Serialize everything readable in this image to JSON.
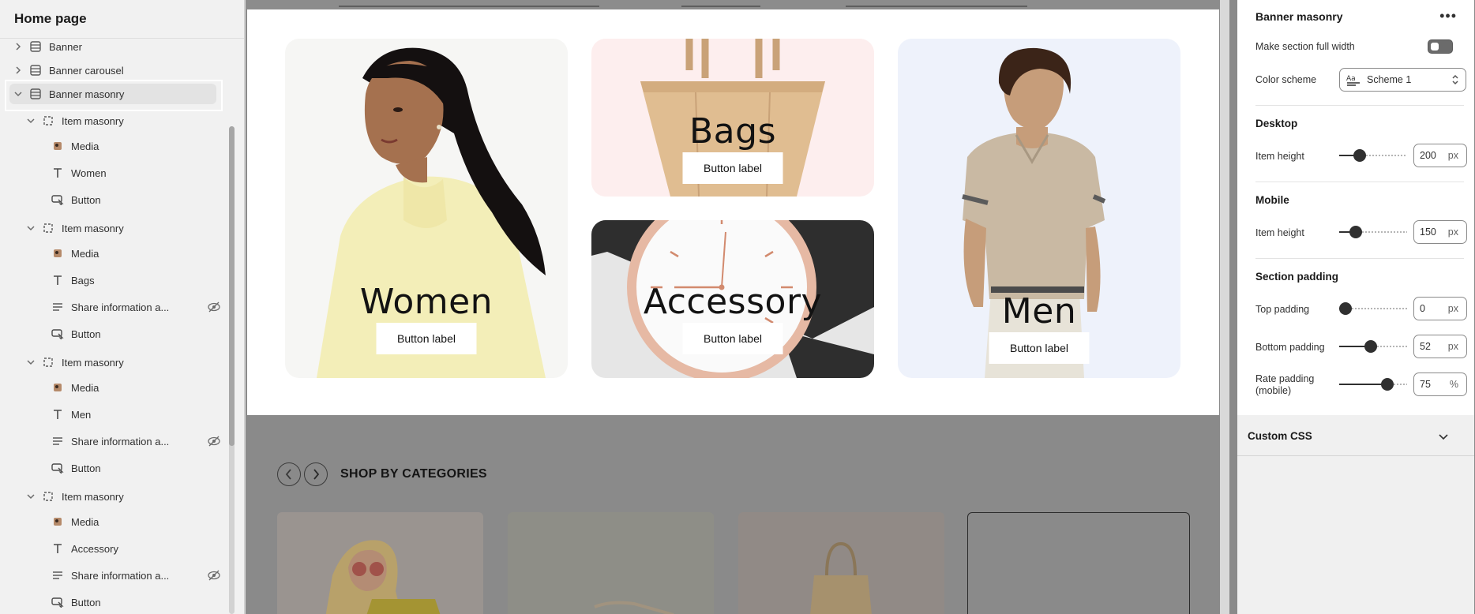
{
  "sidebar": {
    "title": "Home page",
    "tree": [
      {
        "label": "Banner",
        "level": 0,
        "chevron": "right",
        "icon": "section-icon"
      },
      {
        "label": "Banner carousel",
        "level": 0,
        "chevron": "right",
        "icon": "section-icon"
      },
      {
        "label": "Banner masonry",
        "level": 0,
        "chevron": "down",
        "icon": "section-icon",
        "selected": true
      },
      {
        "label": "Item masonry",
        "level": 1,
        "chevron": "down",
        "icon": "block-icon"
      },
      {
        "label": "Media",
        "level": 2,
        "icon": "media-icon"
      },
      {
        "label": "Women",
        "level": 2,
        "icon": "text-icon"
      },
      {
        "label": "Button",
        "level": 2,
        "icon": "button-icon"
      },
      {
        "label": "Item masonry",
        "level": 1,
        "chevron": "down",
        "icon": "block-icon"
      },
      {
        "label": "Media",
        "level": 2,
        "icon": "media-icon"
      },
      {
        "label": "Bags",
        "level": 2,
        "icon": "text-icon"
      },
      {
        "label": "Share information a...",
        "level": 2,
        "icon": "lines-icon",
        "hidden": true
      },
      {
        "label": "Button",
        "level": 2,
        "icon": "button-icon"
      },
      {
        "label": "Item masonry",
        "level": 1,
        "chevron": "down",
        "icon": "block-icon"
      },
      {
        "label": "Media",
        "level": 2,
        "icon": "media-icon"
      },
      {
        "label": "Men",
        "level": 2,
        "icon": "text-icon"
      },
      {
        "label": "Share information a...",
        "level": 2,
        "icon": "lines-icon",
        "hidden": true
      },
      {
        "label": "Button",
        "level": 2,
        "icon": "button-icon"
      },
      {
        "label": "Item masonry",
        "level": 1,
        "chevron": "down",
        "icon": "block-icon"
      },
      {
        "label": "Media",
        "level": 2,
        "icon": "media-icon"
      },
      {
        "label": "Accessory",
        "level": 2,
        "icon": "text-icon"
      },
      {
        "label": "Share information a...",
        "level": 2,
        "icon": "lines-icon",
        "hidden": true
      },
      {
        "label": "Button",
        "level": 2,
        "icon": "button-icon"
      }
    ]
  },
  "preview": {
    "cards": {
      "women": {
        "heading": "Women",
        "button": "Button label"
      },
      "bags": {
        "heading": "Bags",
        "button": "Button label"
      },
      "accessory": {
        "heading": "Accessory",
        "button": "Button label"
      },
      "men": {
        "heading": "Men",
        "button": "Button label"
      }
    },
    "categories": {
      "title": "SHOP BY CATEGORIES"
    }
  },
  "settings": {
    "title": "Banner masonry",
    "full_width_label": "Make section full width",
    "full_width_on": false,
    "color_scheme_label": "Color scheme",
    "color_scheme_value": "Scheme 1",
    "desktop": {
      "heading": "Desktop",
      "item_height_label": "Item height",
      "item_height": "200",
      "unit": "px",
      "slider_fraction": 0.25
    },
    "mobile": {
      "heading": "Mobile",
      "item_height_label": "Item height",
      "item_height": "150",
      "unit": "px",
      "slider_fraction": 0.18
    },
    "padding": {
      "heading": "Section padding",
      "top_label": "Top padding",
      "top_value": "0",
      "top_unit": "px",
      "top_fraction": 0.0,
      "bottom_label": "Bottom padding",
      "bottom_value": "52",
      "bottom_unit": "px",
      "bottom_fraction": 0.45,
      "rate_label_1": "Rate padding",
      "rate_label_2": "(mobile)",
      "rate_value": "75",
      "rate_unit": "%",
      "rate_fraction": 0.75
    },
    "custom_css_label": "Custom CSS"
  }
}
